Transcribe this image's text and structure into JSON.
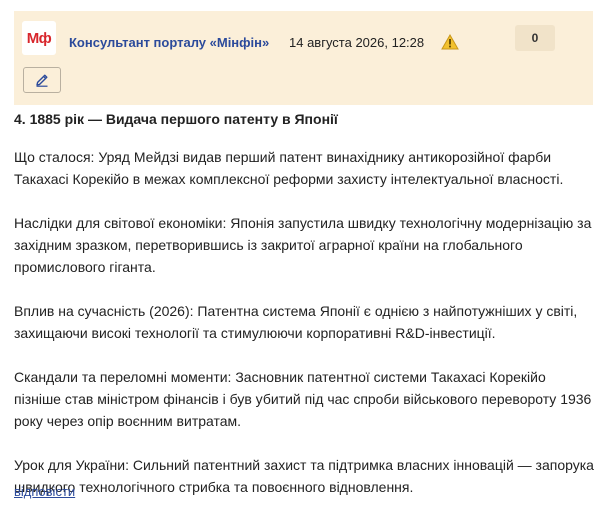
{
  "header": {
    "logo_text": "Мф",
    "author": "Консультант порталу «Мінфін»",
    "date": "14 августа 2026, 12:28",
    "warning_icon": "warning-icon",
    "counter": "0",
    "edit_icon": "pencil-icon"
  },
  "post": {
    "title": "4. 1885 рік — Видача першого патенту в Японії",
    "paragraphs": [
      "Що сталося: Уряд Мейдзі видав перший патент винахіднику антикорозійної фарби Такахасі Корекійо в межах комплексної реформи захисту інтелектуальної власності.",
      "Наслідки для світової економіки: Японія запустила швидку технологічну модернізацію за західним зразком, перетворившись із закритої аграрної країни на глобального промислового гіганта.",
      "Вплив на сучасність (2026): Патентна система Японії є однією з найпотужніших у світі, захищаючи високі технології та стимулюючи корпоративні R&D-інвестиції.",
      "Скандали та переломні моменти: Засновник патентної системи Такахасі Корекійо пізніше став міністром фінансів і був убитий під час спроби військового перевороту 1936 року через опір воєнним витратам.",
      "Урок для України: Сильний патентний захист та підтримка власних інновацій — запорука швидкого технологічного стрибка та повоєнного відновлення."
    ]
  },
  "reply_label": "відповісти",
  "colors": {
    "header_bg": "#fbefd9",
    "logo_red": "#d8262c",
    "link_blue": "#2b4a9b",
    "warning_yellow": "#f2c12e"
  }
}
